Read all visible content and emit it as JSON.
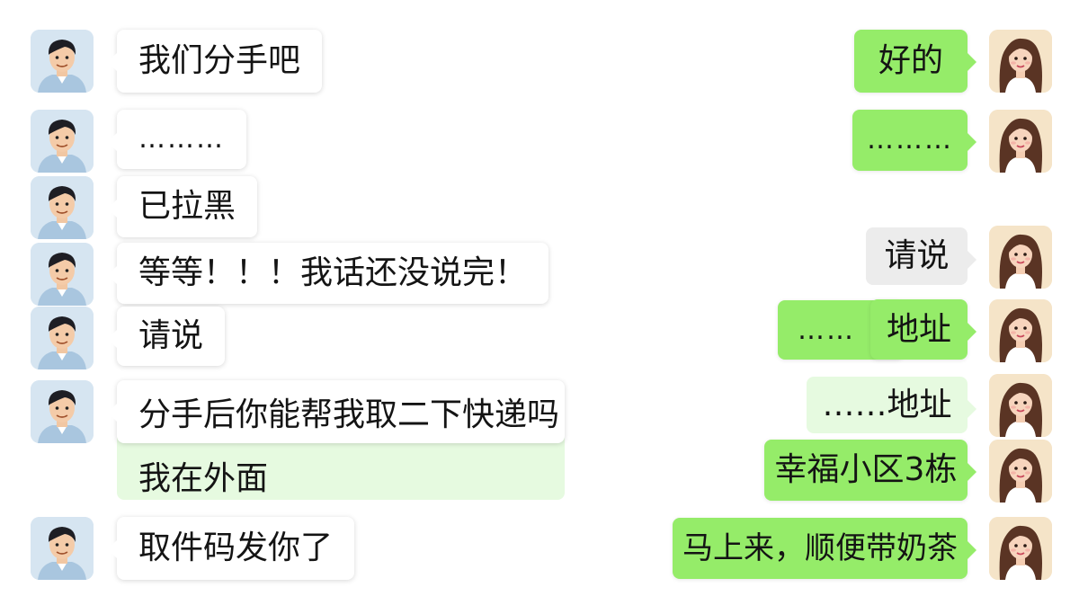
{
  "chat": {
    "left": [
      {
        "text": "我们分手吧"
      },
      {
        "text": "………"
      },
      {
        "text": "已拉黑"
      },
      {
        "text": "等等！！！我话还没说完！"
      },
      {
        "text": "请说"
      },
      {
        "text": "分手后你能帮我取二下快递吗"
      },
      {
        "text": "我在外面"
      },
      {
        "text": "取件码发你了"
      }
    ],
    "right": [
      {
        "text": "好的"
      },
      {
        "text": "………"
      },
      {
        "text": "请说"
      },
      {
        "text": "……"
      },
      {
        "text": "地址"
      },
      {
        "text": "……地址"
      },
      {
        "text": "幸福小区3栋"
      },
      {
        "text": "马上来，顺便带奶茶"
      }
    ]
  },
  "colors": {
    "sent_bubble": "#95ec69",
    "received_bubble": "#ffffff",
    "gray_bubble": "#ececec",
    "mint_bubble": "#e6fae0"
  },
  "avatars": {
    "left": "man-avatar-icon",
    "right": "woman-avatar-icon"
  }
}
